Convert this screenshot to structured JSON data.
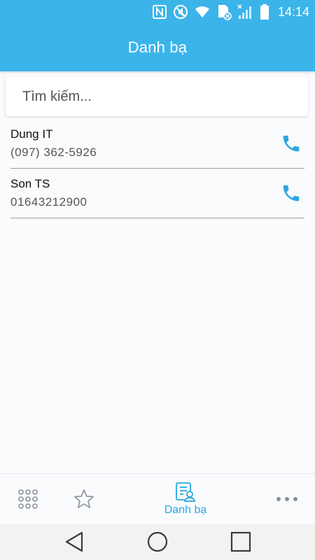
{
  "status_bar": {
    "time": "14:14",
    "icons": [
      "nfc-icon",
      "mute-icon",
      "wifi-icon",
      "sim-error-icon",
      "signal-icon",
      "battery-icon"
    ]
  },
  "header": {
    "title": "Danh bạ"
  },
  "search": {
    "placeholder": "Tìm kiếm...",
    "value": ""
  },
  "contacts": [
    {
      "name": "Dung IT",
      "phone": "(097) 362-5926"
    },
    {
      "name": "Son TS",
      "phone": "01643212900"
    }
  ],
  "tabs": [
    {
      "icon": "dialpad-icon",
      "label": ""
    },
    {
      "icon": "star-icon",
      "label": ""
    },
    {
      "icon": "contacts-icon",
      "label": "Danh bạ",
      "active": true
    },
    {
      "icon": "more-icon",
      "label": ""
    }
  ],
  "nav": [
    "back-icon",
    "home-icon",
    "recents-icon"
  ],
  "colors": {
    "accent": "#3bb4ea",
    "phone_icon": "#2aa6df"
  }
}
